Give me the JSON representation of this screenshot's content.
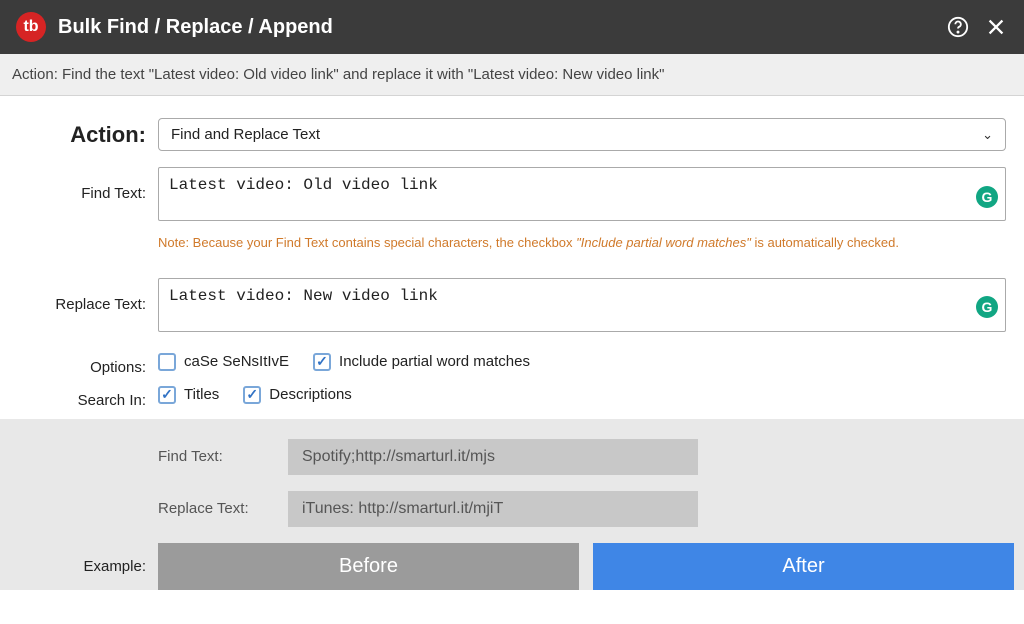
{
  "header": {
    "logo_text": "tb",
    "title": "Bulk Find / Replace / Append"
  },
  "summary": "Action: Find the text \"Latest video: Old video link\" and replace it with \"Latest video: New video link\"",
  "form": {
    "action_label": "Action:",
    "action_value": "Find and Replace Text",
    "find_label": "Find Text:",
    "find_value": "Latest video: Old video link",
    "note_prefix": "Note: Because your Find Text contains special characters, the checkbox ",
    "note_italic": "\"Include partial word matches\"",
    "note_suffix": " is automatically checked.",
    "replace_label": "Replace Text:",
    "replace_value": "Latest video: New video link",
    "options_label": "Options:",
    "opt_case": "caSe SeNsItIvE",
    "opt_partial": "Include partial word matches",
    "searchin_label": "Search In:",
    "si_titles": "Titles",
    "si_descriptions": "Descriptions",
    "grammarly_glyph": "G"
  },
  "example": {
    "label": "Example:",
    "find_label": "Find Text:",
    "find_value": "Spotify;http://smarturl.it/mjs",
    "replace_label": "Replace Text:",
    "replace_value": "iTunes: http://smarturl.it/mjiT",
    "before": "Before",
    "after": "After"
  }
}
